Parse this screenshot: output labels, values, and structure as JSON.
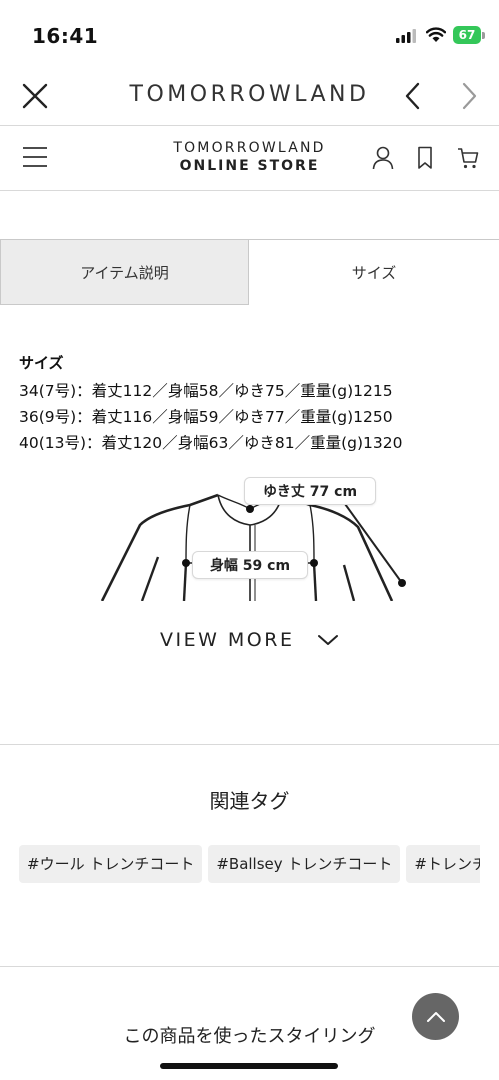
{
  "status_bar": {
    "time": "16:41",
    "battery": "67"
  },
  "browser": {
    "title": "TOMORROWLAND"
  },
  "store": {
    "logo_line1": "TOMORROWLAND",
    "logo_line2": "ONLINE STORE"
  },
  "tabs": [
    {
      "label": "アイテム説明",
      "active": false
    },
    {
      "label": "サイズ",
      "active": true
    }
  ],
  "size_info": {
    "heading": "サイズ",
    "rows": [
      "34(7号)：着丈112／身幅58／ゆき75／重量(g)1215",
      "36(9号)：着丈116／身幅59／ゆき77／重量(g)1250",
      "40(13号)：着丈120／身幅63／ゆき81／重量(g)1320"
    ]
  },
  "diagram": {
    "sleeve_label": "ゆき丈 77 cm",
    "width_label": "身幅 59 cm"
  },
  "view_more": "VIEW MORE",
  "related_tags": {
    "title": "関連タグ",
    "tags": [
      "#ウール トレンチコート",
      "#Ballsey トレンチコート",
      "#トレンチコート"
    ]
  },
  "styling_title": "この商品を使ったスタイリング",
  "colors": {
    "battery": "#34c759",
    "tab_inactive_bg": "#ececec",
    "chip_bg": "#efefef",
    "scroll_button": "#666666"
  },
  "icons": [
    "signal-icon",
    "wifi-icon",
    "close-icon",
    "back-icon",
    "forward-icon",
    "menu-icon",
    "user-icon",
    "bookmark-icon",
    "cart-icon",
    "chevron-down-icon",
    "arrow-up-icon"
  ]
}
